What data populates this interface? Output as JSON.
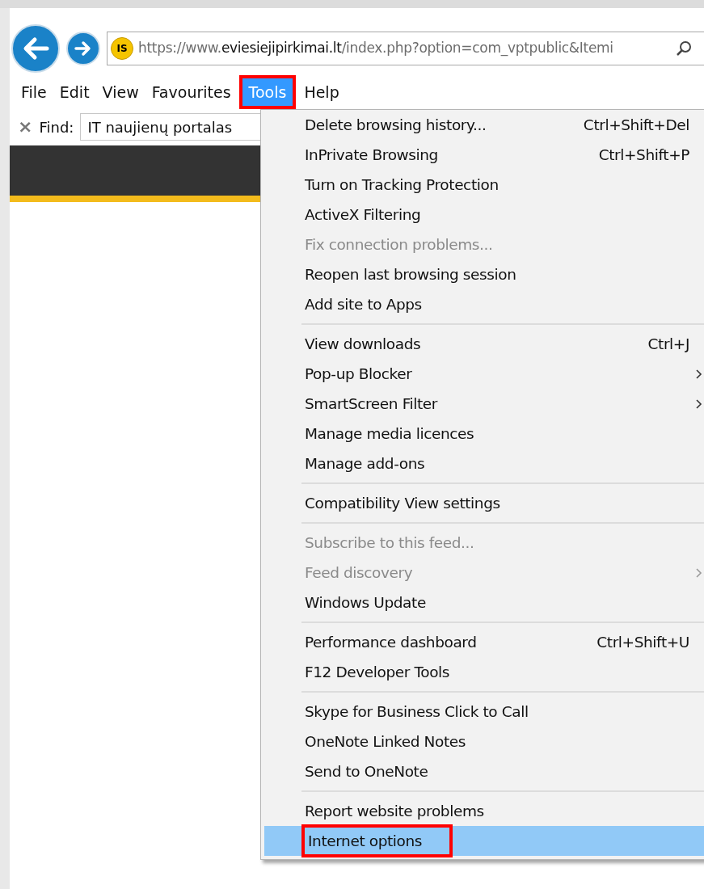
{
  "address_bar": {
    "site_badge": "IS",
    "url_prefix": "https://www.",
    "url_domain": "eviesiejipirkimai.lt",
    "url_rest": "/index.php?option=com_vptpublic&Itemi"
  },
  "menu_bar": [
    {
      "label": "File",
      "selected": false,
      "highlighted": false
    },
    {
      "label": "Edit",
      "selected": false,
      "highlighted": false
    },
    {
      "label": "View",
      "selected": false,
      "highlighted": false
    },
    {
      "label": "Favourites",
      "selected": false,
      "highlighted": false
    },
    {
      "label": "Tools",
      "selected": true,
      "highlighted": true
    },
    {
      "label": "Help",
      "selected": false,
      "highlighted": false
    }
  ],
  "find_bar": {
    "close": "×",
    "label": "Find:",
    "value": "IT naujienų portalas"
  },
  "tools_menu": [
    {
      "kind": "item",
      "label": "Delete browsing history...",
      "shortcut": "Ctrl+Shift+Del",
      "submenu": false,
      "disabled": false,
      "selected": false,
      "highlighted": false
    },
    {
      "kind": "item",
      "label": "InPrivate Browsing",
      "shortcut": "Ctrl+Shift+P",
      "submenu": false,
      "disabled": false,
      "selected": false,
      "highlighted": false
    },
    {
      "kind": "item",
      "label": "Turn on Tracking Protection",
      "submenu": false,
      "disabled": false,
      "selected": false,
      "highlighted": false
    },
    {
      "kind": "item",
      "label": "ActiveX Filtering",
      "submenu": false,
      "disabled": false,
      "selected": false,
      "highlighted": false
    },
    {
      "kind": "item",
      "label": "Fix connection problems...",
      "submenu": false,
      "disabled": true,
      "selected": false,
      "highlighted": false
    },
    {
      "kind": "item",
      "label": "Reopen last browsing session",
      "submenu": false,
      "disabled": false,
      "selected": false,
      "highlighted": false
    },
    {
      "kind": "item",
      "label": "Add site to Apps",
      "submenu": false,
      "disabled": false,
      "selected": false,
      "highlighted": false
    },
    {
      "kind": "separator"
    },
    {
      "kind": "item",
      "label": "View downloads",
      "shortcut": "Ctrl+J",
      "submenu": false,
      "disabled": false,
      "selected": false,
      "highlighted": false
    },
    {
      "kind": "item",
      "label": "Pop-up Blocker",
      "submenu": true,
      "disabled": false,
      "selected": false,
      "highlighted": false
    },
    {
      "kind": "item",
      "label": "SmartScreen Filter",
      "submenu": true,
      "disabled": false,
      "selected": false,
      "highlighted": false
    },
    {
      "kind": "item",
      "label": "Manage media licences",
      "submenu": false,
      "disabled": false,
      "selected": false,
      "highlighted": false
    },
    {
      "kind": "item",
      "label": "Manage add-ons",
      "submenu": false,
      "disabled": false,
      "selected": false,
      "highlighted": false
    },
    {
      "kind": "separator"
    },
    {
      "kind": "item",
      "label": "Compatibility View settings",
      "submenu": false,
      "disabled": false,
      "selected": false,
      "highlighted": false
    },
    {
      "kind": "separator"
    },
    {
      "kind": "item",
      "label": "Subscribe to this feed...",
      "submenu": false,
      "disabled": true,
      "selected": false,
      "highlighted": false
    },
    {
      "kind": "item",
      "label": "Feed discovery",
      "submenu": true,
      "disabled": true,
      "selected": false,
      "highlighted": false
    },
    {
      "kind": "item",
      "label": "Windows Update",
      "submenu": false,
      "disabled": false,
      "selected": false,
      "highlighted": false
    },
    {
      "kind": "separator"
    },
    {
      "kind": "item",
      "label": "Performance dashboard",
      "shortcut": "Ctrl+Shift+U",
      "submenu": false,
      "disabled": false,
      "selected": false,
      "highlighted": false
    },
    {
      "kind": "item",
      "label": "F12 Developer Tools",
      "submenu": false,
      "disabled": false,
      "selected": false,
      "highlighted": false
    },
    {
      "kind": "separator"
    },
    {
      "kind": "item",
      "label": "Skype for Business Click to Call",
      "submenu": false,
      "disabled": false,
      "selected": false,
      "highlighted": false
    },
    {
      "kind": "item",
      "label": "OneNote Linked Notes",
      "submenu": false,
      "disabled": false,
      "selected": false,
      "highlighted": false
    },
    {
      "kind": "item",
      "label": "Send to OneNote",
      "submenu": false,
      "disabled": false,
      "selected": false,
      "highlighted": false
    },
    {
      "kind": "separator"
    },
    {
      "kind": "item",
      "label": "Report website problems",
      "submenu": false,
      "disabled": false,
      "selected": false,
      "highlighted": false
    },
    {
      "kind": "item",
      "label": "Internet options",
      "submenu": false,
      "disabled": false,
      "selected": true,
      "highlighted": true
    }
  ]
}
